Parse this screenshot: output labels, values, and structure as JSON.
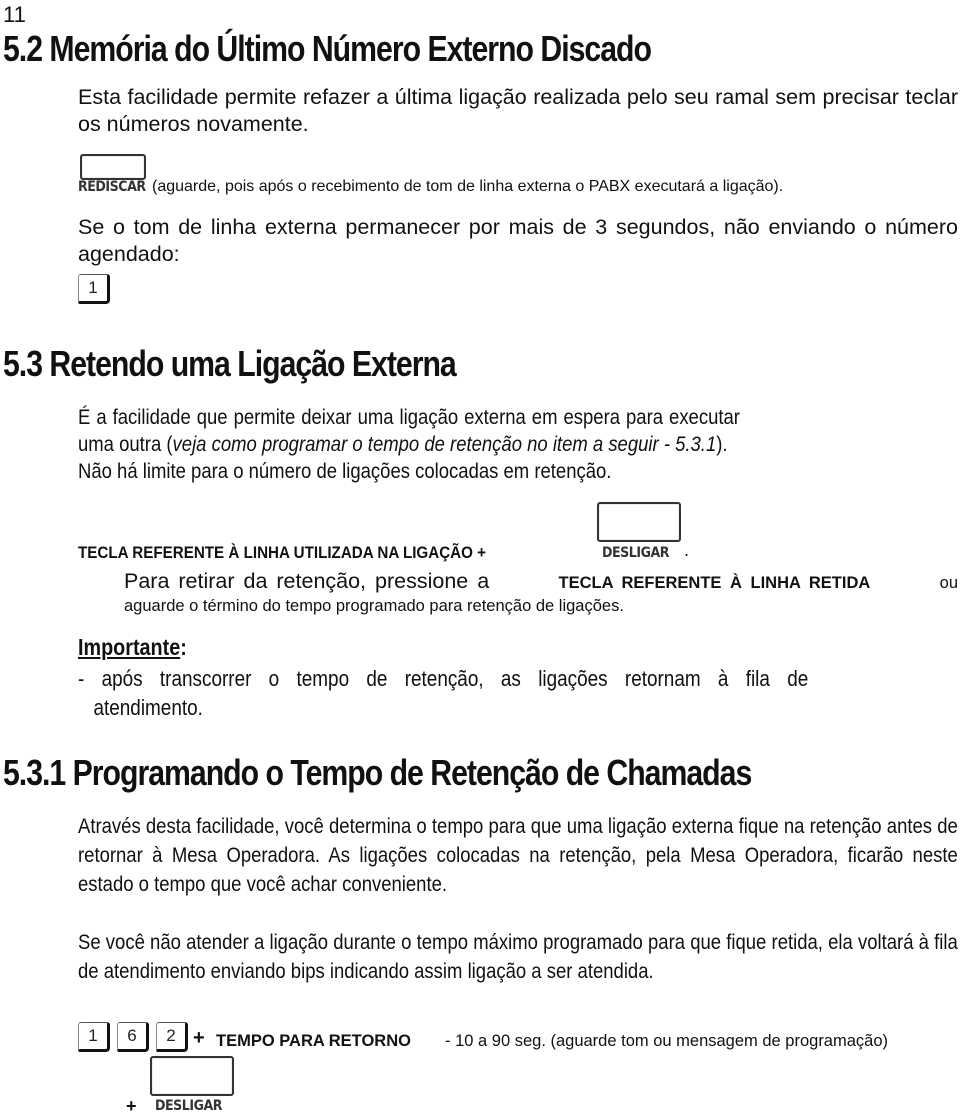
{
  "page_number": "11",
  "section_5_2": {
    "title": "5.2 Memória do Último Número Externo Discado",
    "intro": "Esta facilidade permite refazer a última ligação realizada pelo seu ramal sem precisar teclar os números novamente.",
    "key_rediscar": "REDISCAR",
    "rediscar_note": "(aguarde, pois após o recebimento de tom de linha externa o PABX executará a ligação).",
    "tone_note": "Se o tom de linha externa permanecer por mais de 3 segundos, não enviando o número agendado:",
    "digit_key": "1"
  },
  "section_5_3": {
    "title": "5.3 Retendo uma Ligação Externa",
    "line1": "É a facilidade que permite deixar uma ligação externa em espera para executar",
    "line2_prefix": "uma outra (",
    "line2_italic": "veja como programar o tempo de retenção no item a seguir - 5.3.1",
    "line2_suffix": ").",
    "line3": "Não há limite para o número de ligações colocadas em retenção.",
    "instruction": "TECLA REFERENTE À LINHA UTILIZADA NA LIGAÇÃO +",
    "key_desligar": "DESLIGAR",
    "instruction_end": ".",
    "release_prefix": "Para retirar da retenção, pressione a",
    "release_key": "TECLA REFERENTE À LINHA RETIDA",
    "release_suffix": "ou",
    "release_line2": "aguarde o término do tempo programado para retenção de ligações.",
    "important_label": "Importante",
    "important_colon": ":",
    "important_text": "- após transcorrer o tempo de retenção, as ligações retornam à fila de",
    "important_text2": "atendimento."
  },
  "section_5_3_1": {
    "title": "5.3.1 Programando o Tempo de Retenção de Chamadas",
    "para1": "Através desta facilidade, você determina o tempo para que uma ligação externa fique na retenção antes de retornar à Mesa Operadora. As ligações colocadas na retenção, pela Mesa Operadora, ficarão neste estado o tempo que você achar conveniente.",
    "para2": "Se você não atender a ligação durante o tempo máximo programado para que fique retida, ela voltará à fila de atendimento enviando bips indicando assim ligação a ser atendida.",
    "digit_keys": [
      "1",
      "6",
      "2"
    ],
    "plus": "+",
    "tempo_label": "TEMPO PARA RETORNO",
    "tempo_range": "- 10 a 90 seg. (aguarde tom ou mensagem de programação)",
    "key_desligar": "DESLIGAR"
  }
}
